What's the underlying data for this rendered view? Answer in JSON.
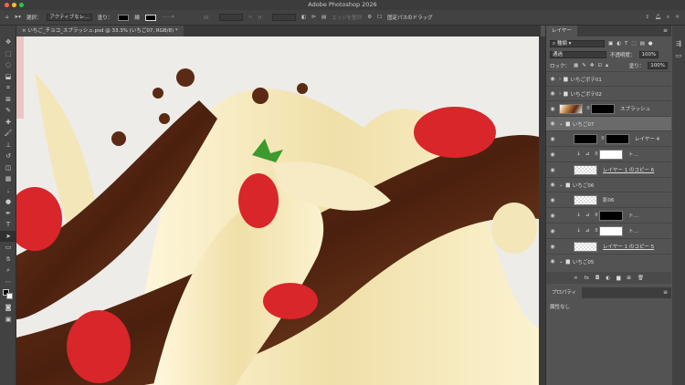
{
  "window": {
    "title": "Adobe Photoshop 2026"
  },
  "options": {
    "select_label": "選択：",
    "select_value": "アクティブなレ…",
    "fill_label": "塗り：",
    "stroke_label": "線",
    "w_label": "W：",
    "h_label": "H：",
    "edge_label": "エッジを整列",
    "constrain_label": "固定パスのドラッグ"
  },
  "document_tab": {
    "title": "いちご_チョコ_スプラッシュ.psd @ 33.3% (いちご07, RGB/8) *"
  },
  "layers_panel": {
    "tab": "レイヤー",
    "filter": "種類",
    "blend_mode": "通過",
    "opacity_label": "不透明度：",
    "opacity": "100%",
    "lock_label": "ロック：",
    "fill_label": "塗り：",
    "fill": "100%",
    "layers": [
      {
        "name": "いちごボテ01",
        "type": "group",
        "collapsed": true
      },
      {
        "name": "いちごボテ02",
        "type": "group",
        "collapsed": true
      },
      {
        "name": "スプラッシュ",
        "type": "layer-mask"
      },
      {
        "name": "いちご07",
        "type": "group",
        "selected": true
      },
      {
        "name": "レイヤー 4",
        "type": "layer-mask"
      },
      {
        "name": "ト…",
        "type": "adjustment-white"
      },
      {
        "name": "レイヤー 1 のコピー 6",
        "type": "smart"
      },
      {
        "name": "いちご06",
        "type": "group"
      },
      {
        "name": "影06",
        "type": "layer"
      },
      {
        "name": "ト…",
        "type": "adjustment-black"
      },
      {
        "name": "ト…",
        "type": "adjustment-white"
      },
      {
        "name": "レイヤー 1 のコピー 5",
        "type": "smart"
      },
      {
        "name": "いちご05",
        "type": "group"
      }
    ]
  },
  "properties_panel": {
    "tab": "プロパティ",
    "content": "属性なし"
  },
  "colors": {
    "accent_selected": "#6a6a6a",
    "chocolate": "#5a2a14",
    "cream": "#f3e6b8",
    "strawberry": "#d8262a"
  }
}
